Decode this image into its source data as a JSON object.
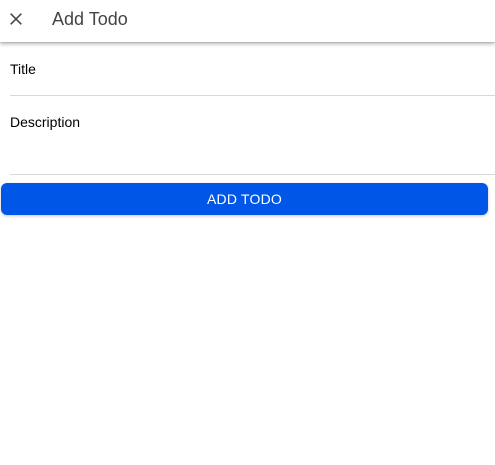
{
  "toolbar": {
    "title": "Add Todo",
    "close_icon": "close-icon"
  },
  "form": {
    "title_placeholder": "Title",
    "title_value": "",
    "description_placeholder": "Description",
    "description_value": ""
  },
  "actions": {
    "add_label": "ADD TODO"
  },
  "colors": {
    "primary": "#0057e7",
    "toolbar_title": "#444444",
    "divider": "#d8d8d8"
  }
}
